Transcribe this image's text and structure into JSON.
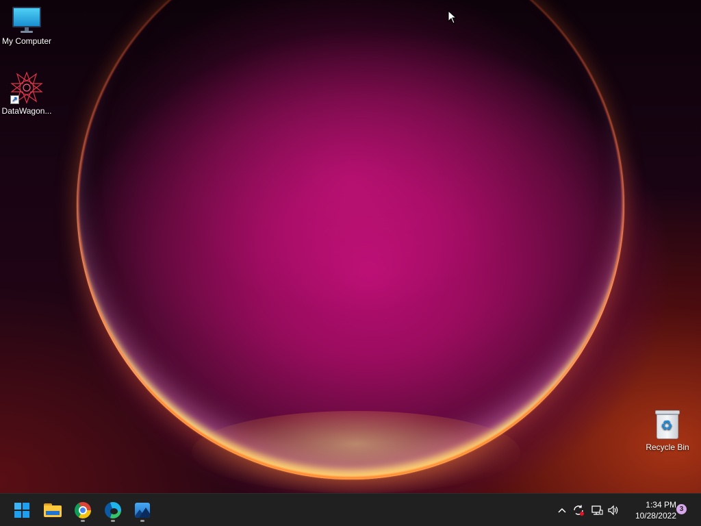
{
  "desktop": {
    "icons": [
      {
        "label": "My Computer",
        "icon": "monitor-icon"
      },
      {
        "label": "DataWagon...",
        "icon": "datawagon-star-icon"
      },
      {
        "label": "Recycle Bin",
        "icon": "recycle-bin-icon"
      }
    ]
  },
  "taskbar": {
    "apps": [
      {
        "name": "Start",
        "icon": "windows-start-icon"
      },
      {
        "name": "File Explorer",
        "icon": "folder-icon"
      },
      {
        "name": "Google Chrome",
        "icon": "chrome-icon"
      },
      {
        "name": "Microsoft Edge",
        "icon": "edge-icon"
      },
      {
        "name": "Photos",
        "icon": "photos-icon"
      }
    ],
    "tray": {
      "overflow_glyph": "^",
      "volume_glyph": "🔊",
      "time": "1:34 PM",
      "date": "10/28/2022",
      "notification_count": "3"
    }
  },
  "colors": {
    "taskbar_bg": "#202020",
    "accent_blue": "#1ea0f0",
    "notification_badge": "#d7a8ea"
  }
}
